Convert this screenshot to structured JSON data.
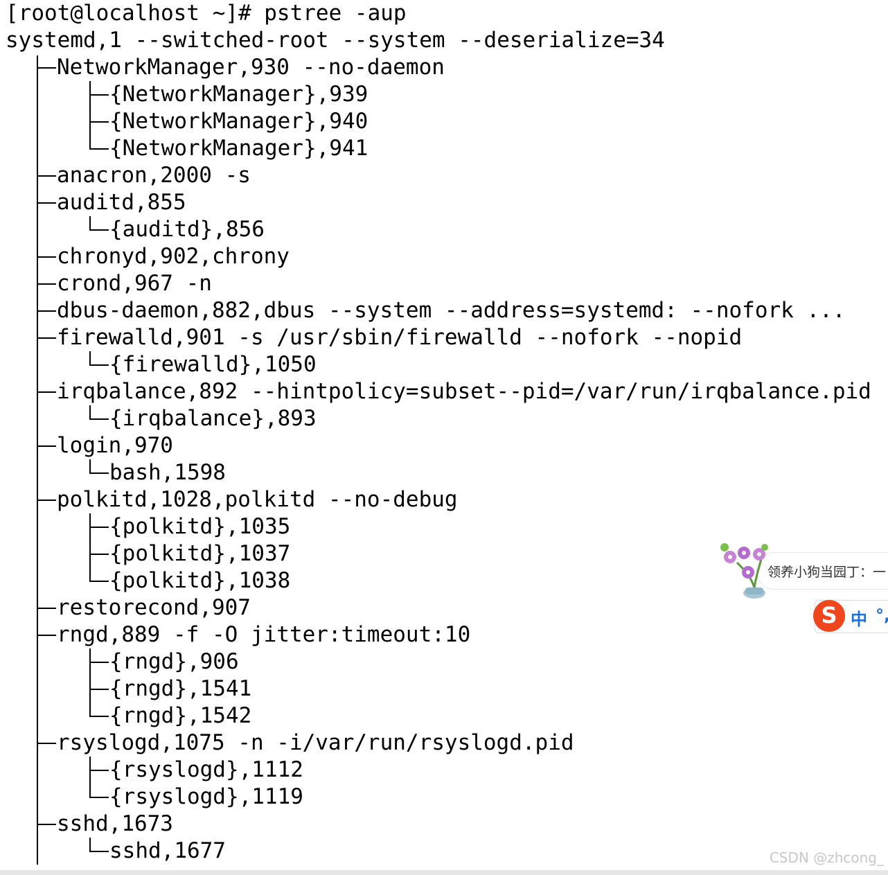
{
  "terminal": {
    "prompt_line": "[root@localhost ~]# pstree -aup",
    "root_line": "systemd,1 --switched-root --system --deserialize=34",
    "lines": [
      "NetworkManager,930 --no-daemon",
      "{NetworkManager},939",
      "{NetworkManager},940",
      "{NetworkManager},941",
      "anacron,2000 -s",
      "auditd,855",
      "{auditd},856",
      "chronyd,902,chrony",
      "crond,967 -n",
      "dbus-daemon,882,dbus --system --address=systemd: --nofork ...",
      "firewalld,901 -s /usr/sbin/firewalld --nofork --nopid",
      "{firewalld},1050",
      "irqbalance,892 --hintpolicy=subset--pid=/var/run/irqbalance.pid",
      "{irqbalance},893",
      "login,970",
      "bash,1598",
      "polkitd,1028,polkitd --no-debug",
      "{polkitd},1035",
      "{polkitd},1037",
      "{polkitd},1038",
      "restorecond,907",
      "rngd,889 -f -O jitter:timeout:10",
      "{rngd},906",
      "{rngd},1541",
      "{rngd},1542",
      "rsyslogd,1075 -n -i/var/run/rsyslogd.pid",
      "{rsyslogd},1112",
      "{rsyslogd},1119",
      "sshd,1673",
      "sshd,1677"
    ]
  },
  "popup": {
    "text": "领养小狗当园丁：一"
  },
  "ime": {
    "logo": "S",
    "mode": "中",
    "punct": "°,"
  },
  "watermark": "CSDN @zhcong_"
}
